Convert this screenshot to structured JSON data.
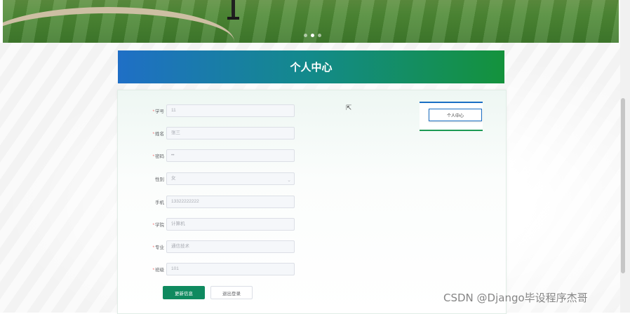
{
  "carousel": {
    "dots": 3,
    "active_index": 1
  },
  "page_title": "个人中心",
  "form": {
    "fields": [
      {
        "label": "学号",
        "required": true,
        "value": "11"
      },
      {
        "label": "姓名",
        "required": true,
        "value": "张三"
      },
      {
        "label": "密码",
        "required": true,
        "value": "••"
      },
      {
        "label": "性别",
        "required": false,
        "value": "女",
        "type": "select"
      },
      {
        "label": "手机",
        "required": false,
        "value": "13322222222"
      },
      {
        "label": "学院",
        "required": true,
        "value": "计算机"
      },
      {
        "label": "专业",
        "required": true,
        "value": "通信技术"
      },
      {
        "label": "班级",
        "required": true,
        "value": "101"
      }
    ],
    "update_button": "更新信息",
    "logout_button": "退出登录"
  },
  "side_menu": {
    "item": "个人中心"
  },
  "watermark": "CSDN @Django毕设程序杰哥",
  "colors": {
    "title_gradient_start": "#1f6fc6",
    "title_gradient_end": "#14923c",
    "primary_button": "#0f8a5f"
  }
}
